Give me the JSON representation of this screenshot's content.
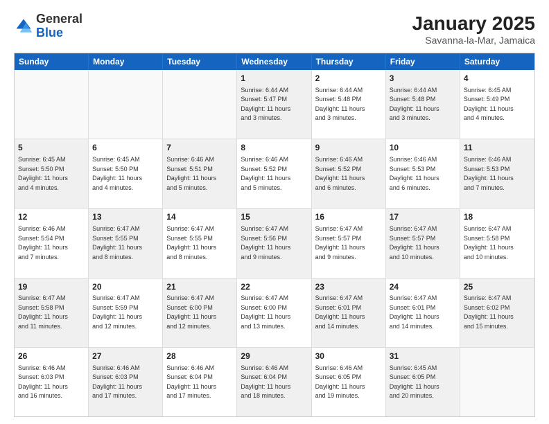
{
  "header": {
    "logo_general": "General",
    "logo_blue": "Blue",
    "month_title": "January 2025",
    "location": "Savanna-la-Mar, Jamaica"
  },
  "weekdays": [
    "Sunday",
    "Monday",
    "Tuesday",
    "Wednesday",
    "Thursday",
    "Friday",
    "Saturday"
  ],
  "rows": [
    [
      {
        "day": "",
        "info": "",
        "empty": true
      },
      {
        "day": "",
        "info": "",
        "empty": true
      },
      {
        "day": "",
        "info": "",
        "empty": true
      },
      {
        "day": "1",
        "info": "Sunrise: 6:44 AM\nSunset: 5:47 PM\nDaylight: 11 hours\nand 3 minutes.",
        "shaded": true
      },
      {
        "day": "2",
        "info": "Sunrise: 6:44 AM\nSunset: 5:48 PM\nDaylight: 11 hours\nand 3 minutes."
      },
      {
        "day": "3",
        "info": "Sunrise: 6:44 AM\nSunset: 5:48 PM\nDaylight: 11 hours\nand 3 minutes.",
        "shaded": true
      },
      {
        "day": "4",
        "info": "Sunrise: 6:45 AM\nSunset: 5:49 PM\nDaylight: 11 hours\nand 4 minutes."
      }
    ],
    [
      {
        "day": "5",
        "info": "Sunrise: 6:45 AM\nSunset: 5:50 PM\nDaylight: 11 hours\nand 4 minutes.",
        "shaded": true
      },
      {
        "day": "6",
        "info": "Sunrise: 6:45 AM\nSunset: 5:50 PM\nDaylight: 11 hours\nand 4 minutes."
      },
      {
        "day": "7",
        "info": "Sunrise: 6:46 AM\nSunset: 5:51 PM\nDaylight: 11 hours\nand 5 minutes.",
        "shaded": true
      },
      {
        "day": "8",
        "info": "Sunrise: 6:46 AM\nSunset: 5:52 PM\nDaylight: 11 hours\nand 5 minutes."
      },
      {
        "day": "9",
        "info": "Sunrise: 6:46 AM\nSunset: 5:52 PM\nDaylight: 11 hours\nand 6 minutes.",
        "shaded": true
      },
      {
        "day": "10",
        "info": "Sunrise: 6:46 AM\nSunset: 5:53 PM\nDaylight: 11 hours\nand 6 minutes."
      },
      {
        "day": "11",
        "info": "Sunrise: 6:46 AM\nSunset: 5:53 PM\nDaylight: 11 hours\nand 7 minutes.",
        "shaded": true
      }
    ],
    [
      {
        "day": "12",
        "info": "Sunrise: 6:46 AM\nSunset: 5:54 PM\nDaylight: 11 hours\nand 7 minutes."
      },
      {
        "day": "13",
        "info": "Sunrise: 6:47 AM\nSunset: 5:55 PM\nDaylight: 11 hours\nand 8 minutes.",
        "shaded": true
      },
      {
        "day": "14",
        "info": "Sunrise: 6:47 AM\nSunset: 5:55 PM\nDaylight: 11 hours\nand 8 minutes."
      },
      {
        "day": "15",
        "info": "Sunrise: 6:47 AM\nSunset: 5:56 PM\nDaylight: 11 hours\nand 9 minutes.",
        "shaded": true
      },
      {
        "day": "16",
        "info": "Sunrise: 6:47 AM\nSunset: 5:57 PM\nDaylight: 11 hours\nand 9 minutes."
      },
      {
        "day": "17",
        "info": "Sunrise: 6:47 AM\nSunset: 5:57 PM\nDaylight: 11 hours\nand 10 minutes.",
        "shaded": true
      },
      {
        "day": "18",
        "info": "Sunrise: 6:47 AM\nSunset: 5:58 PM\nDaylight: 11 hours\nand 10 minutes."
      }
    ],
    [
      {
        "day": "19",
        "info": "Sunrise: 6:47 AM\nSunset: 5:58 PM\nDaylight: 11 hours\nand 11 minutes.",
        "shaded": true
      },
      {
        "day": "20",
        "info": "Sunrise: 6:47 AM\nSunset: 5:59 PM\nDaylight: 11 hours\nand 12 minutes."
      },
      {
        "day": "21",
        "info": "Sunrise: 6:47 AM\nSunset: 6:00 PM\nDaylight: 11 hours\nand 12 minutes.",
        "shaded": true
      },
      {
        "day": "22",
        "info": "Sunrise: 6:47 AM\nSunset: 6:00 PM\nDaylight: 11 hours\nand 13 minutes."
      },
      {
        "day": "23",
        "info": "Sunrise: 6:47 AM\nSunset: 6:01 PM\nDaylight: 11 hours\nand 14 minutes.",
        "shaded": true
      },
      {
        "day": "24",
        "info": "Sunrise: 6:47 AM\nSunset: 6:01 PM\nDaylight: 11 hours\nand 14 minutes."
      },
      {
        "day": "25",
        "info": "Sunrise: 6:47 AM\nSunset: 6:02 PM\nDaylight: 11 hours\nand 15 minutes.",
        "shaded": true
      }
    ],
    [
      {
        "day": "26",
        "info": "Sunrise: 6:46 AM\nSunset: 6:03 PM\nDaylight: 11 hours\nand 16 minutes."
      },
      {
        "day": "27",
        "info": "Sunrise: 6:46 AM\nSunset: 6:03 PM\nDaylight: 11 hours\nand 17 minutes.",
        "shaded": true
      },
      {
        "day": "28",
        "info": "Sunrise: 6:46 AM\nSunset: 6:04 PM\nDaylight: 11 hours\nand 17 minutes."
      },
      {
        "day": "29",
        "info": "Sunrise: 6:46 AM\nSunset: 6:04 PM\nDaylight: 11 hours\nand 18 minutes.",
        "shaded": true
      },
      {
        "day": "30",
        "info": "Sunrise: 6:46 AM\nSunset: 6:05 PM\nDaylight: 11 hours\nand 19 minutes."
      },
      {
        "day": "31",
        "info": "Sunrise: 6:45 AM\nSunset: 6:05 PM\nDaylight: 11 hours\nand 20 minutes.",
        "shaded": true
      },
      {
        "day": "",
        "info": "",
        "empty": true
      }
    ]
  ]
}
